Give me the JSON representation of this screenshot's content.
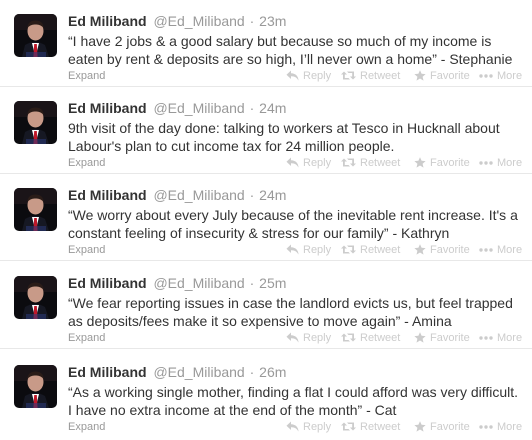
{
  "colors": {
    "name": "#333333",
    "meta": "#999999",
    "action": "#cccccc",
    "avatar_tie": "#c0182a"
  },
  "tweets": [
    {
      "name": "Ed Miliband",
      "handle": "@Ed_Miliband",
      "sep": "·",
      "time": "23m",
      "text": "“I have 2 jobs & a good salary but because so much of my income is eaten by rent & deposits are so high, I’ll never own a home” - Stephanie",
      "expand": "Expand",
      "reply": "Reply",
      "retweet": "Retweet",
      "favorite": "Favorite",
      "more": "More"
    },
    {
      "name": "Ed Miliband",
      "handle": "@Ed_Miliband",
      "sep": "·",
      "time": "24m",
      "text": "9th visit of the day done: talking to workers at Tesco in Hucknall about Labour's plan to cut income tax for 24 million people.",
      "expand": "Expand",
      "reply": "Reply",
      "retweet": "Retweet",
      "favorite": "Favorite",
      "more": "More"
    },
    {
      "name": "Ed Miliband",
      "handle": "@Ed_Miliband",
      "sep": "·",
      "time": "24m",
      "text": "“We worry about every July because of the inevitable rent increase. It's a constant feeling of insecurity & stress for our family” - Kathryn",
      "expand": "Expand",
      "reply": "Reply",
      "retweet": "Retweet",
      "favorite": "Favorite",
      "more": "More"
    },
    {
      "name": "Ed Miliband",
      "handle": "@Ed_Miliband",
      "sep": "·",
      "time": "25m",
      "text": "“We fear reporting issues in case the landlord evicts us, but feel trapped as deposits/fees make it so expensive to move again” - Amina",
      "expand": "Expand",
      "reply": "Reply",
      "retweet": "Retweet",
      "favorite": "Favorite",
      "more": "More"
    },
    {
      "name": "Ed Miliband",
      "handle": "@Ed_Miliband",
      "sep": "·",
      "time": "26m",
      "text": "“As a working single mother, finding a flat I could afford was very difficult. I have no extra income at the end of the month” - Cat",
      "expand": "Expand",
      "reply": "Reply",
      "retweet": "Retweet",
      "favorite": "Favorite",
      "more": "More"
    }
  ]
}
